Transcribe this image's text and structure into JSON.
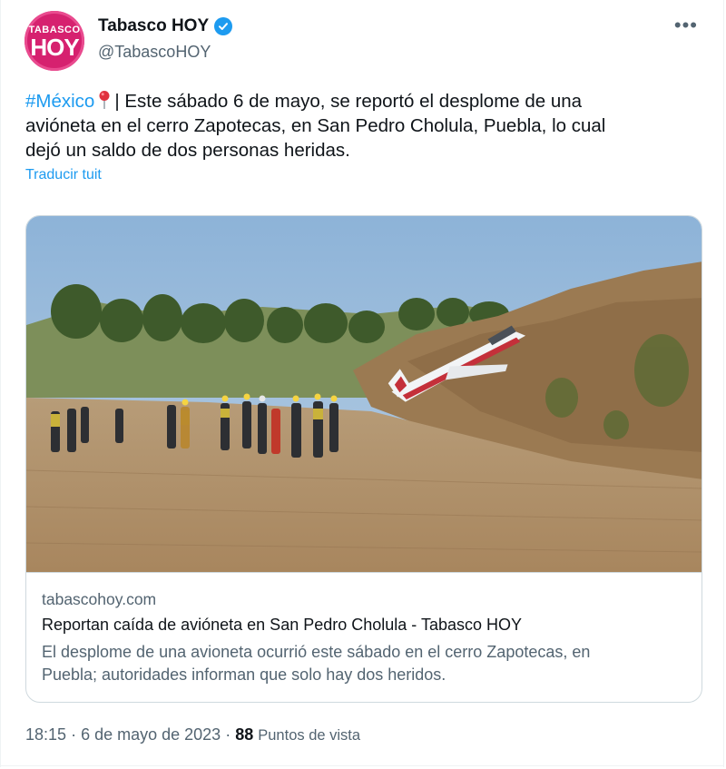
{
  "account": {
    "display_name": "Tabasco HOY",
    "handle": "@TabascoHOY",
    "avatar_text_small": "TABASCO",
    "avatar_text_big": "HOY",
    "verified": true
  },
  "tweet": {
    "hashtag": "#México",
    "text_line1_rest": "| Este sábado 6 de mayo, se reportó el desplome de una",
    "text_line2": "avióneta en el cerro Zapotecas, en San Pedro Cholula, Puebla, lo cual",
    "text_line3": "dejó un saldo de dos personas heridas.",
    "translate_label": "Traducir tuit"
  },
  "card": {
    "domain": "tabascohoy.com",
    "title": "Reportan caída de avióneta en San Pedro Cholula - Tabasco HOY",
    "description_line1": "El desplome de una avioneta ocurrió este sábado en el cerro Zapotecas, en",
    "description_line2": "Puebla; autoridades informan que solo hay dos heridos.",
    "image_alt": "Crashed small plane on a hillside with rescue personnel in a dirt field"
  },
  "footer": {
    "time": "18:15",
    "date": "6 de mayo de 2023",
    "views_count": "88",
    "views_label": "Puntos de vista"
  },
  "colors": {
    "accent": "#1d9bf0",
    "avatar": "#d6216f",
    "secondary_text": "#536471",
    "border": "#cfd9de"
  },
  "icons": {
    "verified": "verified-badge-icon",
    "pin": "round-pushpin-icon",
    "more": "more-horizontal-icon"
  }
}
